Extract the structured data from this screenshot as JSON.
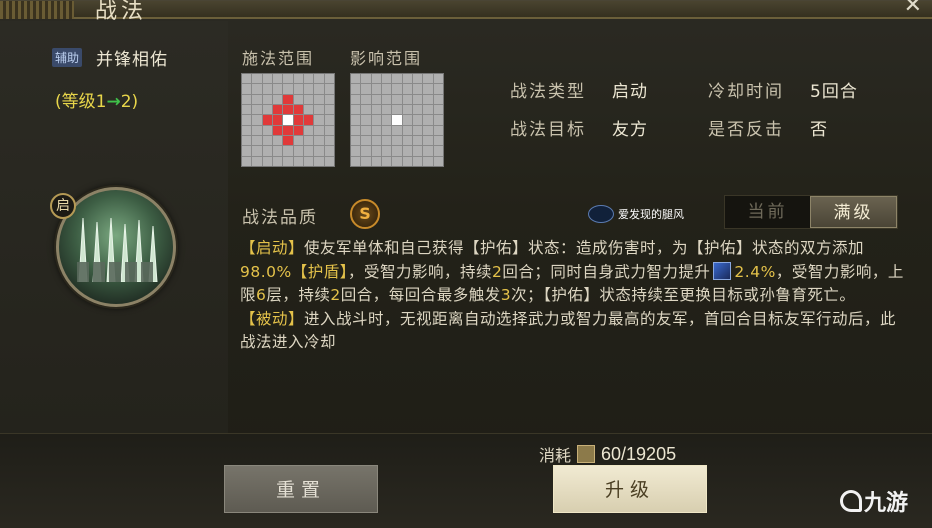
{
  "window": {
    "title": "战法",
    "close_label": "✕"
  },
  "skill": {
    "type_badge": "辅助",
    "name": "并锋相佑",
    "level_prefix": "(等级1",
    "level_arrow": "→",
    "level_suffix": "2)",
    "start_badge": "启",
    "icon": "spear-formation-icon"
  },
  "ranges": {
    "cast_label": "施法范围",
    "effect_label": "影响范围",
    "cast_grid": {
      "size": 9,
      "center": [
        4,
        4
      ],
      "red": [
        [
          3,
          4
        ],
        [
          5,
          4
        ],
        [
          4,
          3
        ],
        [
          4,
          5
        ],
        [
          3,
          3
        ],
        [
          3,
          5
        ],
        [
          5,
          3
        ],
        [
          5,
          5
        ],
        [
          2,
          4
        ],
        [
          6,
          4
        ],
        [
          4,
          2
        ],
        [
          4,
          6
        ]
      ]
    },
    "effect_grid": {
      "size": 9,
      "center": [
        4,
        4
      ],
      "red": []
    }
  },
  "props": {
    "type_label": "战法类型",
    "type_value": "启动",
    "target_label": "战法目标",
    "target_value": "友方",
    "cooldown_label": "冷却时间",
    "cooldown_value": "5回合",
    "counter_label": "是否反击",
    "counter_value": "否",
    "quality_label": "战法品质",
    "quality_value": "S"
  },
  "watermark": {
    "text": "爱发现的腿风"
  },
  "toggle": {
    "current_label": "当前",
    "max_label": "满级",
    "selected": "max"
  },
  "description": {
    "p1_kw1": "【启动】",
    "p1_t1": "使友军单体和自己获得【护佑】状态：造成伤害时，为【护佑】状态的双方添加",
    "p1_num1": "98.0%",
    "p1_kw2": "【护盾】",
    "p1_t2": "，受智力影响，持续",
    "p1_num2": "2",
    "p1_t3": "回合；同时自身武力智力提升",
    "p1_num3": "2.4%",
    "p1_t4": "，受智力影响，上限",
    "p1_num4": "6",
    "p1_t5": "层，持续",
    "p1_num5": "2",
    "p1_t6": "回合，每回合最多触发",
    "p1_num6": "3",
    "p1_t7": "次；【护佑】状态持续至更换目标或孙鲁育死亡。",
    "p2_kw1": "【被动】",
    "p2_t1": "进入战斗时，无视距离自动选择武力或智力最高的友军，首回合目标友军行动后，此战法进入冷却"
  },
  "footer": {
    "cost_label": "消耗",
    "cost_value": "60/19205",
    "reset_label": "重置",
    "upgrade_label": "升级",
    "brand": "九游"
  }
}
